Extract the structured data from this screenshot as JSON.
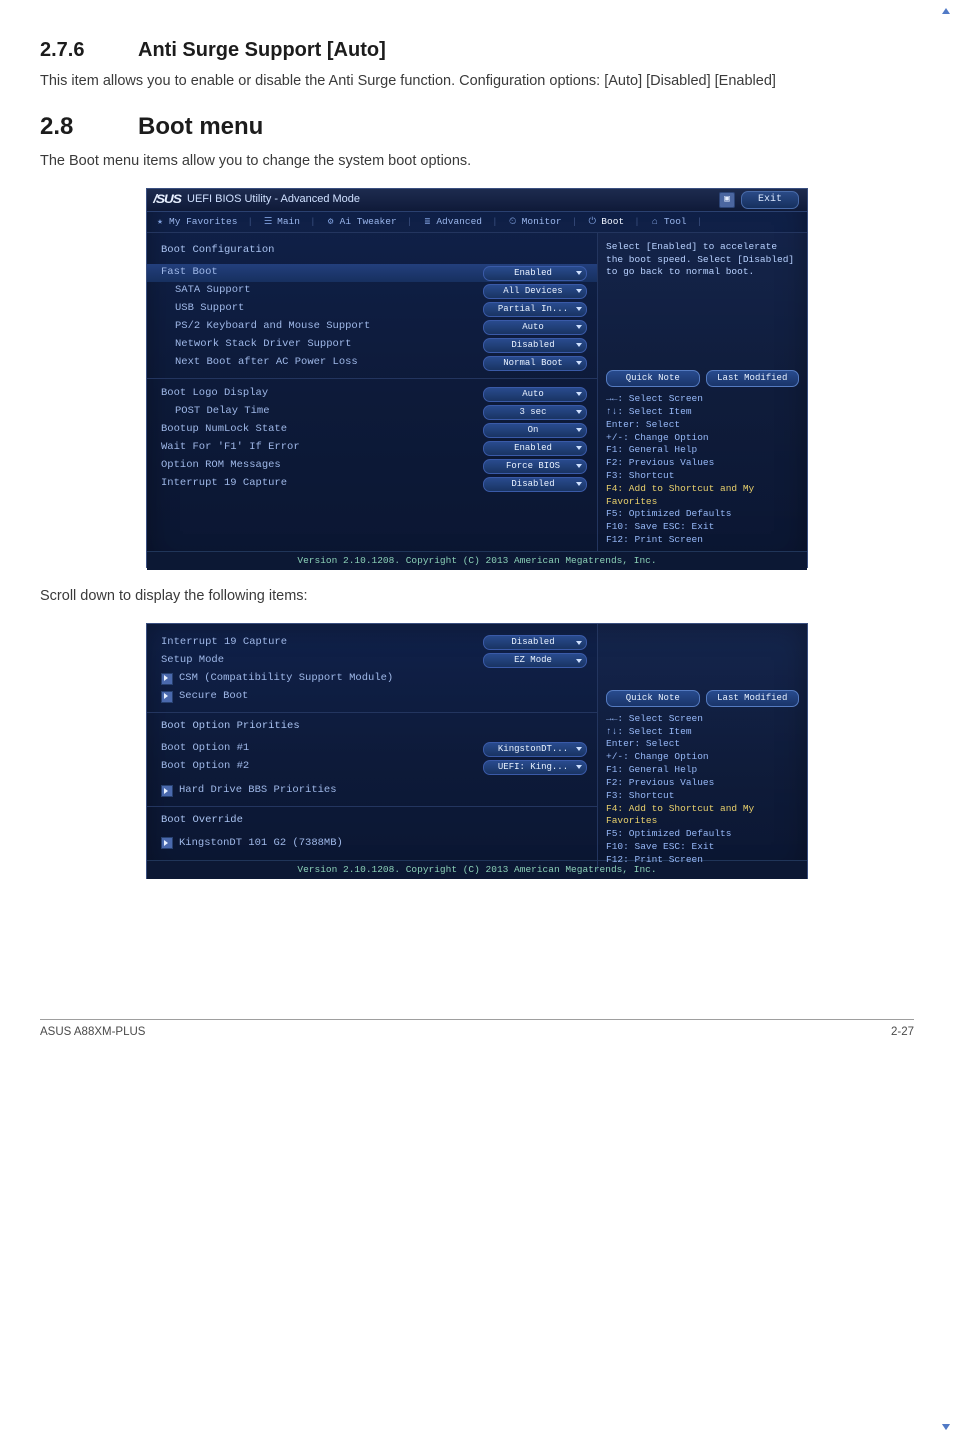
{
  "doc": {
    "sec_sub_num": "2.7.6",
    "sec_sub_title": "Anti Surge Support [Auto]",
    "sec_sub_body": "This item allows you to enable or disable the Anti Surge function. Configuration options: [Auto] [Disabled] [Enabled]",
    "sec_main_num": "2.8",
    "sec_main_title": "Boot menu",
    "sec_main_body": "The Boot menu items allow you to change the system boot options.",
    "caption_scroll": "Scroll down to display the following items:",
    "footer_left": "ASUS A88XM-PLUS",
    "footer_right": "2-27"
  },
  "bios_common": {
    "brand": "/SUS",
    "title": "UEFI BIOS Utility - Advanced Mode",
    "exit_label": "Exit",
    "tabs": [
      {
        "icon": "★",
        "label": "My Favorites"
      },
      {
        "icon": "☰",
        "label": "Main"
      },
      {
        "icon": "⚙",
        "label": "Ai Tweaker"
      },
      {
        "icon": "≣",
        "label": "Advanced"
      },
      {
        "icon": "⏲",
        "label": "Monitor"
      },
      {
        "icon": "⏻",
        "label": "Boot",
        "active": true
      },
      {
        "icon": "⌂",
        "label": "Tool"
      }
    ],
    "quick_note": "Quick Note",
    "last_modified": "Last Modified",
    "help_keys": {
      "l1": "→←: Select Screen",
      "l2": "↑↓: Select Item",
      "l3": "Enter: Select",
      "l4": "+/-: Change Option",
      "l5": "F1: General Help",
      "l6": "F2: Previous Values",
      "l7": "F3: Shortcut",
      "l8": "F4: Add to Shortcut and My Favorites",
      "l9": "F5: Optimized Defaults",
      "l10": "F10: Save  ESC: Exit",
      "l11": "F12: Print Screen"
    },
    "footer": "Version 2.10.1208. Copyright (C) 2013 American Megatrends, Inc."
  },
  "bios1": {
    "section_title": "Boot Configuration",
    "help_desc": "Select [Enabled] to accelerate the boot speed. Select [Disabled] to go back to normal boot.",
    "rows_a": [
      {
        "label": "Fast Boot",
        "value": "Enabled",
        "highlight": true
      },
      {
        "label": "SATA Support",
        "value": "All Devices",
        "indent": true
      },
      {
        "label": "USB Support",
        "value": "Partial In...",
        "indent": true
      },
      {
        "label": "PS/2 Keyboard and Mouse Support",
        "value": "Auto",
        "indent": true
      },
      {
        "label": "Network Stack Driver Support",
        "value": "Disabled",
        "indent": true
      },
      {
        "label": "Next Boot after AC Power Loss",
        "value": "Normal Boot",
        "indent": true
      }
    ],
    "rows_b": [
      {
        "label": "Boot Logo Display",
        "value": "Auto"
      },
      {
        "label": "POST Delay Time",
        "value": "3 sec",
        "indent": true
      },
      {
        "label": "Bootup NumLock State",
        "value": "On"
      },
      {
        "label": "Wait For 'F1' If Error",
        "value": "Enabled"
      },
      {
        "label": "Option ROM Messages",
        "value": "Force BIOS"
      },
      {
        "label": "Interrupt 19 Capture",
        "value": "Disabled"
      }
    ]
  },
  "bios2": {
    "rows_top": [
      {
        "label": "Interrupt 19 Capture",
        "value": "Disabled"
      },
      {
        "label": "Setup Mode",
        "value": "EZ Mode"
      }
    ],
    "submenus_top": [
      "CSM (Compatibility Support Module)",
      "Secure Boot"
    ],
    "priorities_title": "Boot Option Priorities",
    "rows_priorities": [
      {
        "label": "Boot Option #1",
        "value": "KingstonDT..."
      },
      {
        "label": "Boot Option #2",
        "value": "UEFI: King..."
      }
    ],
    "submenus_mid": [
      "Hard Drive BBS Priorities"
    ],
    "override_title": "Boot Override",
    "submenus_override": [
      "KingstonDT 101 G2  (7388MB)"
    ],
    "help_desc": ""
  }
}
